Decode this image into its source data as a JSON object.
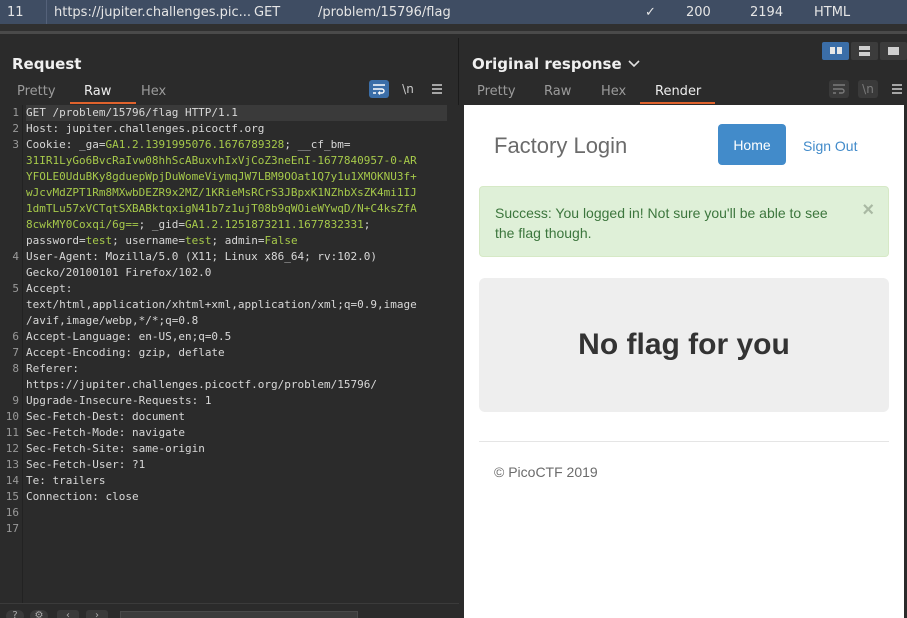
{
  "history_row": {
    "index": "11",
    "url": "https://jupiter.challenges.pic...",
    "method": "GET",
    "path": "/problem/15796/flag",
    "check": "✓",
    "status": "200",
    "length": "2194",
    "mime": "HTML"
  },
  "request": {
    "title": "Request",
    "tabs": [
      "Pretty",
      "Raw",
      "Hex"
    ],
    "active_tab": "Raw",
    "tools": {
      "wrap_icon": "wrap-lines-icon",
      "newline_label": "\\n",
      "menu_icon": "menu-icon"
    },
    "lines": [
      {
        "n": "1",
        "parts": [
          [
            "t",
            "GET /problem/15796/flag HTTP/1.1"
          ]
        ]
      },
      {
        "n": "2",
        "parts": [
          [
            "k",
            "Host"
          ],
          [
            "t",
            ": jupiter.challenges.picoctf.org"
          ]
        ]
      },
      {
        "n": "3",
        "parts": [
          [
            "k",
            "Cookie"
          ],
          [
            "t",
            ": "
          ],
          [
            "k",
            "_ga"
          ],
          [
            "t",
            "="
          ],
          [
            "g",
            "GA1.2.1391995076.1676789328"
          ],
          [
            "t",
            "; "
          ],
          [
            "k",
            "__cf_bm"
          ],
          [
            "t",
            "="
          ]
        ]
      },
      {
        "n": "",
        "parts": [
          [
            "g",
            "31IR1LyGo6BvcRaIvw08hhScABuxvhIxVjCoZ3neEnI-1677840957-0-AR"
          ]
        ]
      },
      {
        "n": "",
        "parts": [
          [
            "g",
            "YFOLE0UduBKy8gduepWpjDuWomeViymqJW7LBM9OOat1Q7y1u1XMOKNU3f+"
          ]
        ]
      },
      {
        "n": "",
        "parts": [
          [
            "g",
            "wJcvMdZPT1Rm8MXwbDEZR9x2MZ/1KRieMsRCrS3JBpxK1NZhbXsZK4mi1IJ"
          ]
        ]
      },
      {
        "n": "",
        "parts": [
          [
            "g",
            "1dmTLu57xVCTqtSXBABktqxigN41b7z1ujT08b9qWOieWYwqD/N+C4ksZfA"
          ]
        ]
      },
      {
        "n": "",
        "parts": [
          [
            "g",
            "8cwkMY0Coxqi/6g=="
          ],
          [
            "t",
            "; "
          ],
          [
            "k",
            "_gid"
          ],
          [
            "t",
            "="
          ],
          [
            "g",
            "GA1.2.1251873211.1677832331"
          ],
          [
            "t",
            ";"
          ]
        ]
      },
      {
        "n": "",
        "parts": [
          [
            "k",
            "password"
          ],
          [
            "t",
            "="
          ],
          [
            "g",
            "test"
          ],
          [
            "t",
            "; "
          ],
          [
            "k",
            "username"
          ],
          [
            "t",
            "="
          ],
          [
            "g",
            "test"
          ],
          [
            "t",
            "; "
          ],
          [
            "k",
            "admin"
          ],
          [
            "t",
            "="
          ],
          [
            "g",
            "False"
          ]
        ]
      },
      {
        "n": "4",
        "parts": [
          [
            "k",
            "User-Agent"
          ],
          [
            "t",
            ": Mozilla/5.0 (X11; Linux x86_64; rv:102.0)"
          ]
        ]
      },
      {
        "n": "",
        "parts": [
          [
            "t",
            "Gecko/20100101 Firefox/102.0"
          ]
        ]
      },
      {
        "n": "5",
        "parts": [
          [
            "k",
            "Accept"
          ],
          [
            "t",
            ":"
          ]
        ]
      },
      {
        "n": "",
        "parts": [
          [
            "t",
            "text/html,application/xhtml+xml,application/xml;q=0.9,image"
          ]
        ]
      },
      {
        "n": "",
        "parts": [
          [
            "t",
            "/avif,image/webp,*/*;q=0.8"
          ]
        ]
      },
      {
        "n": "6",
        "parts": [
          [
            "k",
            "Accept-Language"
          ],
          [
            "t",
            ": en-US,en;q=0.5"
          ]
        ]
      },
      {
        "n": "7",
        "parts": [
          [
            "k",
            "Accept-Encoding"
          ],
          [
            "t",
            ": gzip, deflate"
          ]
        ]
      },
      {
        "n": "8",
        "parts": [
          [
            "k",
            "Referer"
          ],
          [
            "t",
            ":"
          ]
        ]
      },
      {
        "n": "",
        "parts": [
          [
            "t",
            "https://jupiter.challenges.picoctf.org/problem/15796/"
          ]
        ]
      },
      {
        "n": "9",
        "parts": [
          [
            "k",
            "Upgrade-Insecure-Requests"
          ],
          [
            "t",
            ": 1"
          ]
        ]
      },
      {
        "n": "10",
        "parts": [
          [
            "k",
            "Sec-Fetch-Dest"
          ],
          [
            "t",
            ": document"
          ]
        ]
      },
      {
        "n": "11",
        "parts": [
          [
            "k",
            "Sec-Fetch-Mode"
          ],
          [
            "t",
            ": navigate"
          ]
        ]
      },
      {
        "n": "12",
        "parts": [
          [
            "k",
            "Sec-Fetch-Site"
          ],
          [
            "t",
            ": same-origin"
          ]
        ]
      },
      {
        "n": "13",
        "parts": [
          [
            "k",
            "Sec-Fetch-User"
          ],
          [
            "t",
            ": ?1"
          ]
        ]
      },
      {
        "n": "14",
        "parts": [
          [
            "k",
            "Te"
          ],
          [
            "t",
            ": trailers"
          ]
        ]
      },
      {
        "n": "15",
        "parts": [
          [
            "k",
            "Connection"
          ],
          [
            "t",
            ": close"
          ]
        ]
      },
      {
        "n": "16",
        "parts": []
      },
      {
        "n": "17",
        "parts": []
      }
    ]
  },
  "response": {
    "title": "Original response",
    "tabs": [
      "Pretty",
      "Raw",
      "Hex",
      "Render"
    ],
    "active_tab": "Render",
    "rendered_page": {
      "brand": "Factory Login",
      "nav_home": "Home",
      "nav_signout": "Sign Out",
      "alert": "Success: You logged in! Not sure you'll be able to see the flag though.",
      "alert_close": "×",
      "jumbotron": "No flag for you",
      "footer": "© PicoCTF 2019"
    }
  },
  "colors": {
    "accent_tab": "#e0632d",
    "selected_row": "#3f4d63",
    "toggle_on": "#3b6ea8",
    "cookie_value": "#a6c94a",
    "home_button": "#428bca",
    "alert_bg": "#dff0d8"
  }
}
